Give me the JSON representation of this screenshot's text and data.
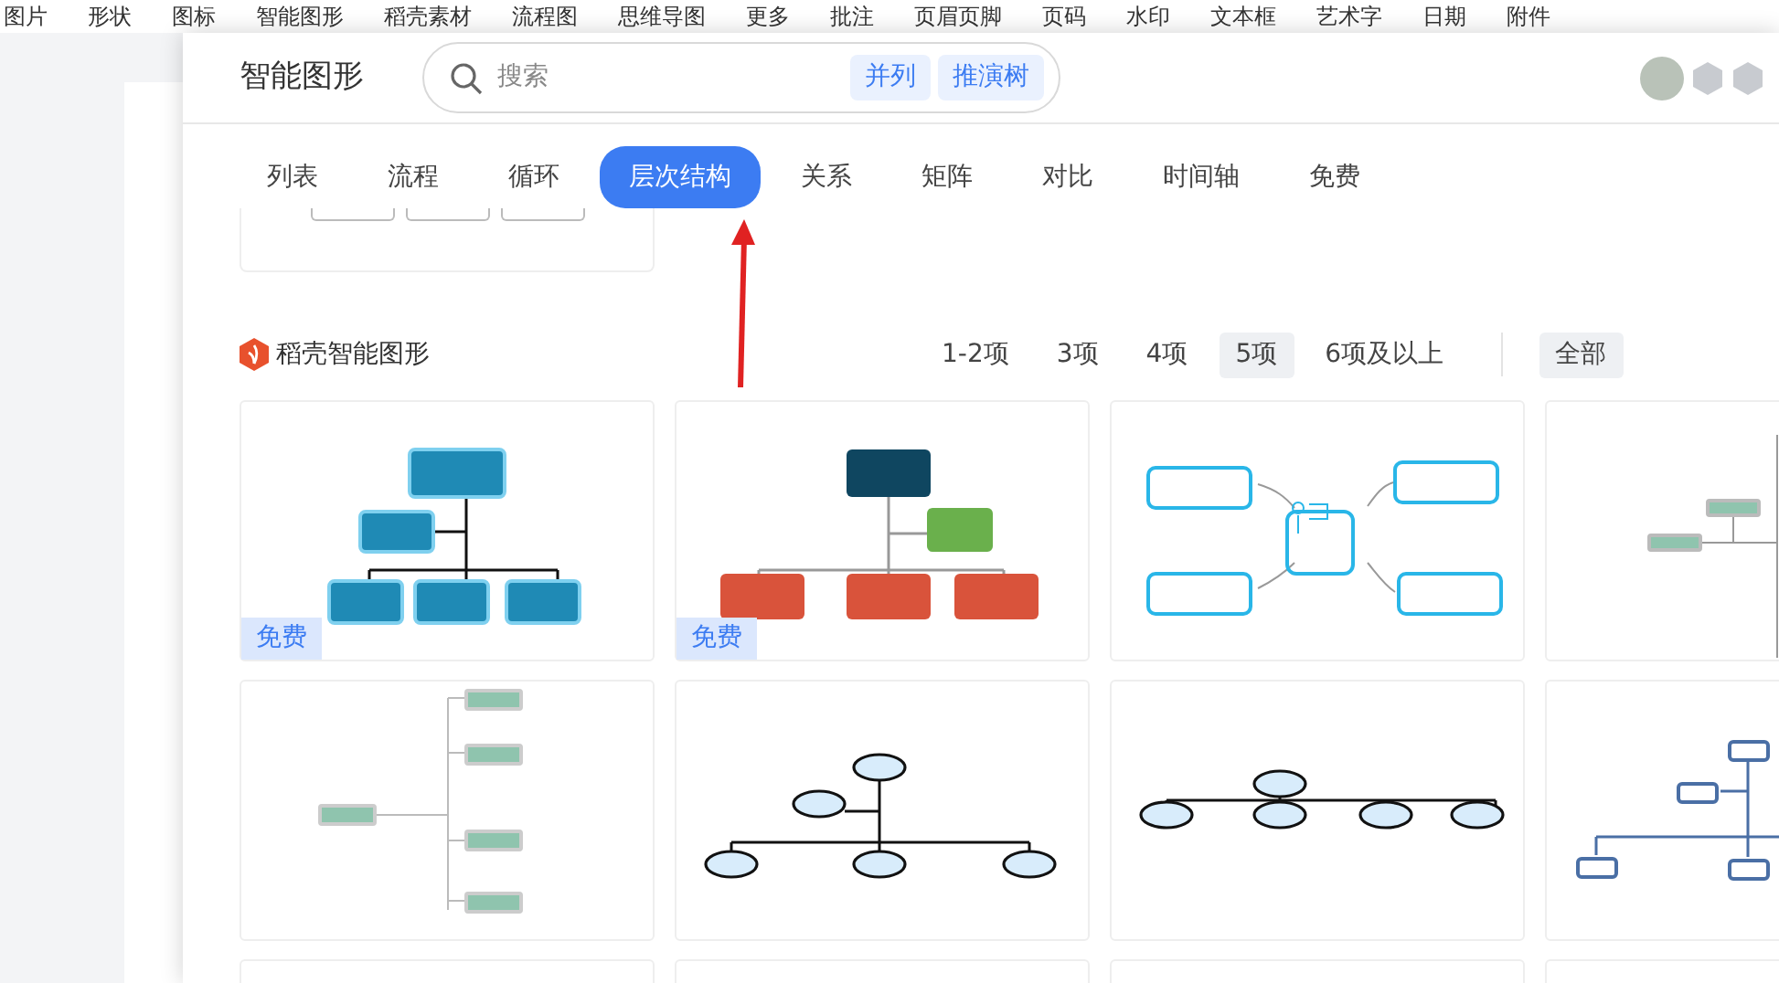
{
  "toolbar": {
    "items": [
      "图片",
      "形状",
      "图标",
      "智能图形",
      "稻壳素材",
      "流程图",
      "思维导图",
      "更多",
      "批注",
      "页眉页脚",
      "页码",
      "水印",
      "文本框",
      "艺术字",
      "日期",
      "附件"
    ]
  },
  "dialog": {
    "title": "智能图形",
    "search": {
      "placeholder": "搜索",
      "tags": [
        "并列",
        "推演树"
      ]
    },
    "tabs": [
      {
        "label": "列表",
        "selected": false
      },
      {
        "label": "流程",
        "selected": false
      },
      {
        "label": "循环",
        "selected": false
      },
      {
        "label": "层次结构",
        "selected": true
      },
      {
        "label": "关系",
        "selected": false
      },
      {
        "label": "矩阵",
        "selected": false
      },
      {
        "label": "对比",
        "selected": false
      },
      {
        "label": "时间轴",
        "selected": false
      },
      {
        "label": "免费",
        "selected": false
      }
    ],
    "section": {
      "title": "稻壳智能图形",
      "filters": [
        {
          "label": "1-2项",
          "selected": false
        },
        {
          "label": "3项",
          "selected": false
        },
        {
          "label": "4项",
          "selected": false
        },
        {
          "label": "5项",
          "selected": true
        },
        {
          "label": "6项及以上",
          "selected": false
        }
      ],
      "scopes": [
        {
          "label": "全部",
          "selected": true
        }
      ]
    },
    "templates": [
      {
        "kind": "org-blue",
        "badge": "免费"
      },
      {
        "kind": "org-red",
        "badge": "免费"
      },
      {
        "kind": "mind-cyan"
      },
      {
        "kind": "tree-left"
      },
      {
        "kind": "tree-right"
      },
      {
        "kind": "tree-cloud"
      },
      {
        "kind": "tree-cloud-wide"
      },
      {
        "kind": "tree-outline"
      },
      {
        "kind": "empty"
      },
      {
        "kind": "empty"
      },
      {
        "kind": "empty"
      },
      {
        "kind": "empty"
      }
    ]
  }
}
